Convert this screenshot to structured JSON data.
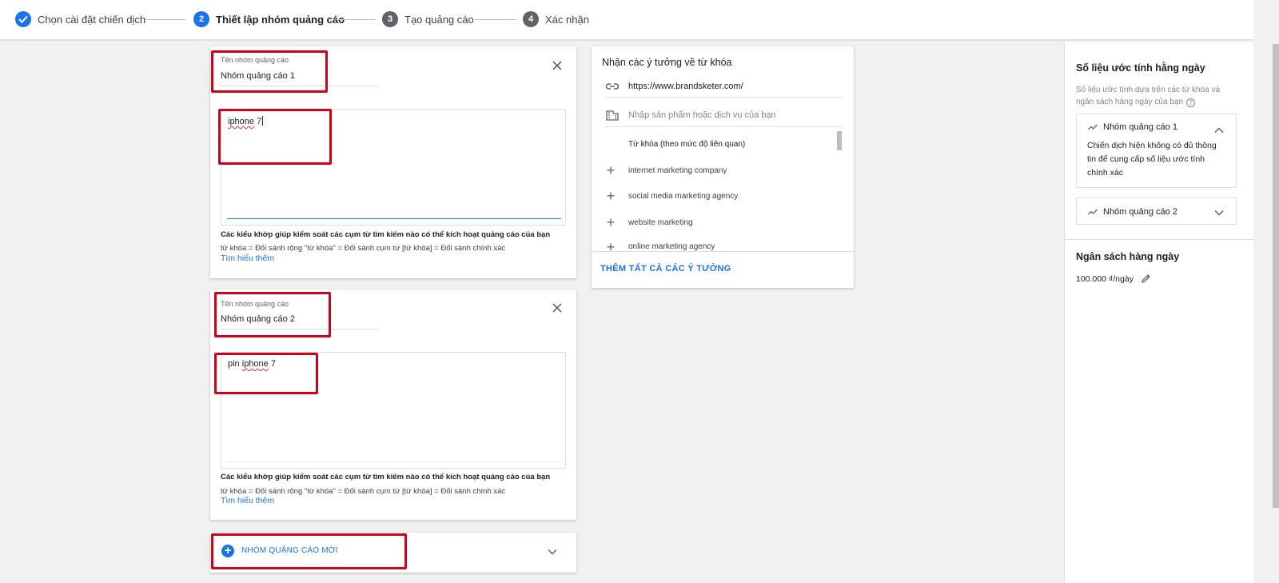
{
  "stepper": {
    "steps": [
      {
        "num": "",
        "label": "Chọn cài đặt chiến dịch",
        "state": "done"
      },
      {
        "num": "2",
        "label": "Thiết lập nhóm quảng cáo",
        "state": "active"
      },
      {
        "num": "3",
        "label": "Tạo quảng cáo",
        "state": "todo"
      },
      {
        "num": "4",
        "label": "Xác nhận",
        "state": "todo"
      }
    ]
  },
  "ad_groups": [
    {
      "name_label": "Tên nhóm quảng cáo",
      "name_value": "Nhóm quảng cáo 1",
      "keyword": "iphone",
      "keyword_suffix": " 7",
      "match_title": "Các kiểu khớp giúp kiểm soát các cụm từ tìm kiếm nào có thể kích hoạt quảng cáo của bạn",
      "match_types": "từ khóa = Đối sánh rộng   \"từ khóa\" = Đối sánh cụm từ   [từ khóa] = Đối sánh chính xác",
      "learn_more": "Tìm hiểu thêm"
    },
    {
      "name_label": "Tên nhóm quảng cáo",
      "name_value": "Nhóm quảng cáo 2",
      "keyword_prefix": "pin ",
      "keyword": "iphone",
      "keyword_suffix": " 7",
      "match_title": "Các kiểu khớp giúp kiểm soát các cụm từ tìm kiếm nào có thể kích hoạt quảng cáo của bạn",
      "match_types": "từ khóa = Đối sánh rộng   \"từ khóa\" = Đối sánh cụm từ   [từ khóa] = Đối sánh chính xác",
      "learn_more": "Tìm hiểu thêm"
    }
  ],
  "new_ad_group": {
    "label": "NHÓM QUẢNG CÁO MỚI"
  },
  "keyword_ideas": {
    "title": "Nhận các ý tưởng về từ khóa",
    "url": "https://www.brandsketer.com/",
    "product_placeholder": "Nhập sản phẩm hoặc dịch vụ của bạn",
    "list_header": "Từ khóa (theo mức độ liên quan)",
    "items": [
      "internet marketing company",
      "social media marketing agency",
      "website marketing",
      "online marketing agency"
    ],
    "add_all": "THÊM TẤT CẢ CÁC Ý TƯỞNG"
  },
  "estimates": {
    "title": "Số liệu ước tính hằng ngày",
    "desc": "Số liệu ước tính dựa trên các từ khóa và ngân sách hàng ngày của bạn",
    "help": "?",
    "groups": [
      {
        "name": "Nhóm quảng cáo 1",
        "message": "Chiến dịch hiện không có đủ thông tin để cung cấp số liệu ước tính chính xác",
        "expanded": true
      },
      {
        "name": "Nhóm quảng cáo 2",
        "expanded": false
      }
    ],
    "budget_title": "Ngân sách hàng ngày",
    "budget_value": "100.000 ₫/ngày"
  },
  "colors": {
    "accent": "#1a73e8",
    "annotation": "#d0021b"
  }
}
